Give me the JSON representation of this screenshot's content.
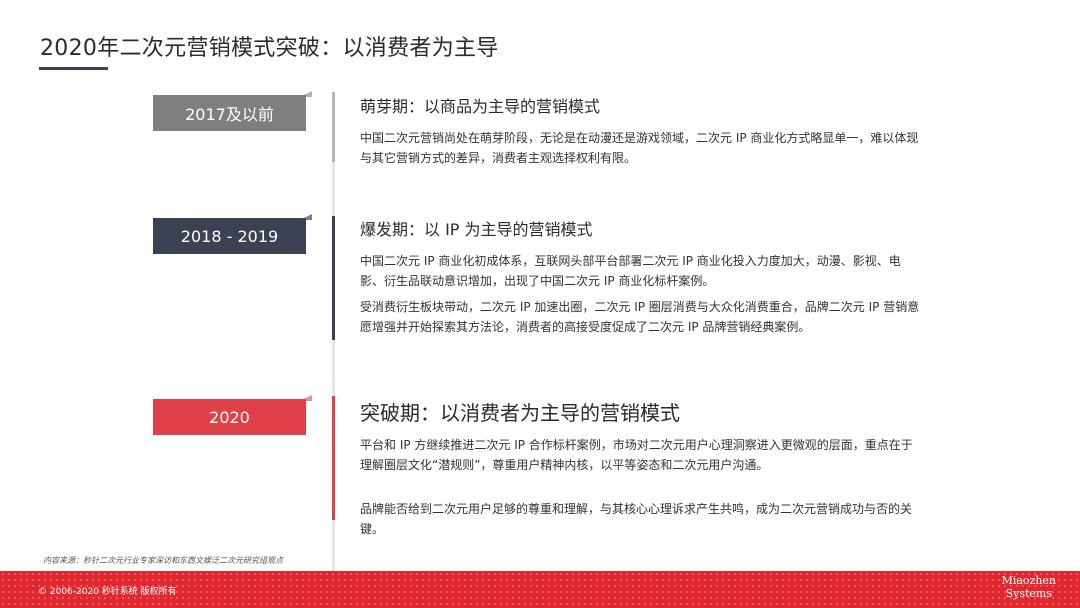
{
  "page": {
    "title": "2020年二次元营销模式突破：以消费者为主导"
  },
  "timeline": [
    {
      "tag": "2017及以前",
      "heading": "萌芽期：以商品为主导的营销模式",
      "paragraphs": [
        "中国二次元营销尚处在萌芽阶段，无论是在动漫还是游戏领域，二次元 IP 商业化方式略显单一，难以体现与其它营销方式的差异，消费者主观选择权利有限。"
      ]
    },
    {
      "tag": "2018 - 2019",
      "heading": "爆发期：以 IP 为主导的营销模式",
      "paragraphs": [
        "中国二次元 IP 商业化初成体系，互联网头部平台部署二次元 IP 商业化投入力度加大，动漫、影视、电影、衍生品联动意识增加，出现了中国二次元 IP 商业化标杆案例。",
        "受消费衍生板块带动，二次元 IP 加速出圈，二次元 IP 圈层消费与大众化消费重合，品牌二次元 IP 营销意愿增强并开始探索其方法论，消费者的高接受度促成了二次元 IP 品牌营销经典案例。"
      ]
    },
    {
      "tag": "2020",
      "heading": "突破期：以消费者为主导的营销模式",
      "paragraphs": [
        "平台和 IP 方继续推进二次元 IP 合作标杆案例，市场对二次元用户心理洞察进入更微观的层面，重点在于理解圈层文化“潜规则”，尊重用户精神内核，以平等姿态和二次元用户沟通。",
        "品牌能否给到二次元用户足够的尊重和理解，与其核心心理诉求产生共鸣，成为二次元营销成功与否的关键。"
      ]
    }
  ],
  "source_note": "内容来源：秒针二次元行业专家深访和东西文娱泛二次元研究组观点",
  "footer": {
    "copyright": "© 2006-2020 秒针系统 版权所有",
    "logo_line1": "Miaozhen",
    "logo_line2": "Systems"
  },
  "colors": {
    "stage1": "#7f7f7f",
    "stage2": "#3c4253",
    "stage3": "#e04148",
    "footer": "#e2282f"
  }
}
